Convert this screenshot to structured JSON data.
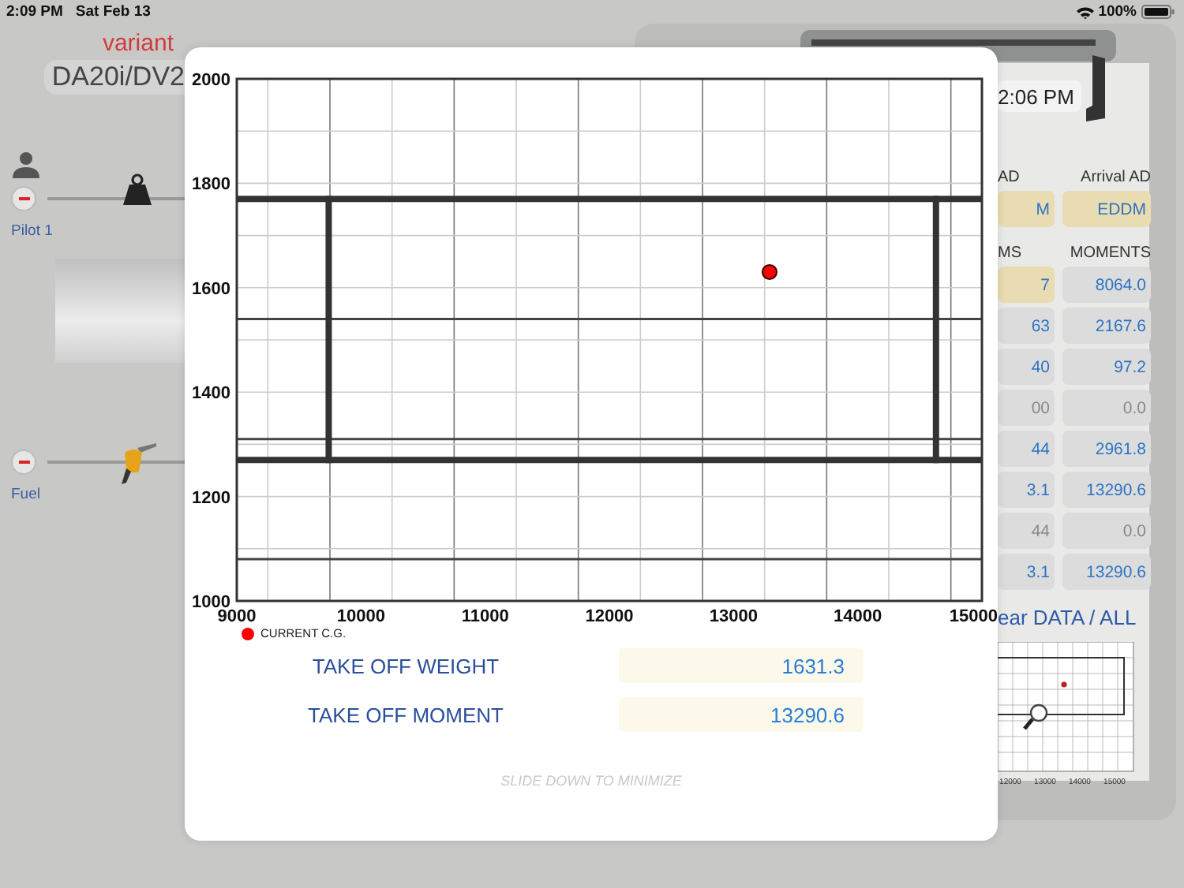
{
  "status_bar": {
    "time": "2:09 PM",
    "date": "Sat Feb 13",
    "battery": "100%"
  },
  "aircraft": {
    "heading": "variant",
    "model": "DA20i/DV2"
  },
  "loads": [
    {
      "kind": "person",
      "label": "Pilot 1"
    },
    {
      "kind": "fuel",
      "label": "Fuel"
    }
  ],
  "clipboard": {
    "time": "2:06 PM",
    "columns": [
      "AD",
      "Arrival AD"
    ],
    "airports": [
      "M",
      "EDDM"
    ],
    "headers": [
      "MS",
      "MOMENTS"
    ],
    "rows": [
      {
        "weight": "7",
        "moment": "8064.0",
        "muted": false,
        "editable": true
      },
      {
        "weight": "63",
        "moment": "2167.6",
        "muted": false,
        "editable": false
      },
      {
        "weight": "40",
        "moment": "97.2",
        "muted": false,
        "editable": false
      },
      {
        "weight": "00",
        "moment": "0.0",
        "muted": true,
        "editable": false
      },
      {
        "weight": "44",
        "moment": "2961.8",
        "muted": false,
        "editable": false
      },
      {
        "weight": "3.1",
        "moment": "13290.6",
        "muted": false,
        "editable": false
      },
      {
        "weight": "44",
        "moment": "0.0",
        "muted": true,
        "editable": false
      },
      {
        "weight": "3.1",
        "moment": "13290.6",
        "muted": false,
        "editable": false
      }
    ],
    "link": "ear DATA / ALL",
    "mini_chart_ticks": [
      "12000",
      "13000",
      "14000",
      "15000"
    ]
  },
  "cg_sheet": {
    "chart_data": {
      "type": "scatter",
      "xlim": [
        9000,
        15000
      ],
      "ylim": [
        1000,
        2000
      ],
      "x": [
        13290
      ],
      "xticks": [
        9000,
        10000,
        11000,
        12000,
        13000,
        14000,
        15000
      ],
      "grid": true,
      "yticks": [
        1000,
        1200,
        1400,
        1600,
        1800,
        2000
      ],
      "series": [
        {
          "name": "CURRENT C.G.",
          "color": "#ff0000",
          "values": [
            1630
          ]
        }
      ],
      "ref_lines": [
        {
          "axis": "x",
          "value": 9740
        },
        {
          "axis": "x",
          "value": 14630
        },
        {
          "axis": "y",
          "value": 1270
        },
        {
          "axis": "y",
          "value": 1770
        }
      ]
    },
    "totals": [
      {
        "label": "TAKE OFF WEIGHT",
        "value": "1631.3"
      },
      {
        "label": "TAKE OFF MOMENT",
        "value": "13290.6"
      }
    ],
    "hint": "SLIDE DOWN TO MINIMIZE"
  }
}
